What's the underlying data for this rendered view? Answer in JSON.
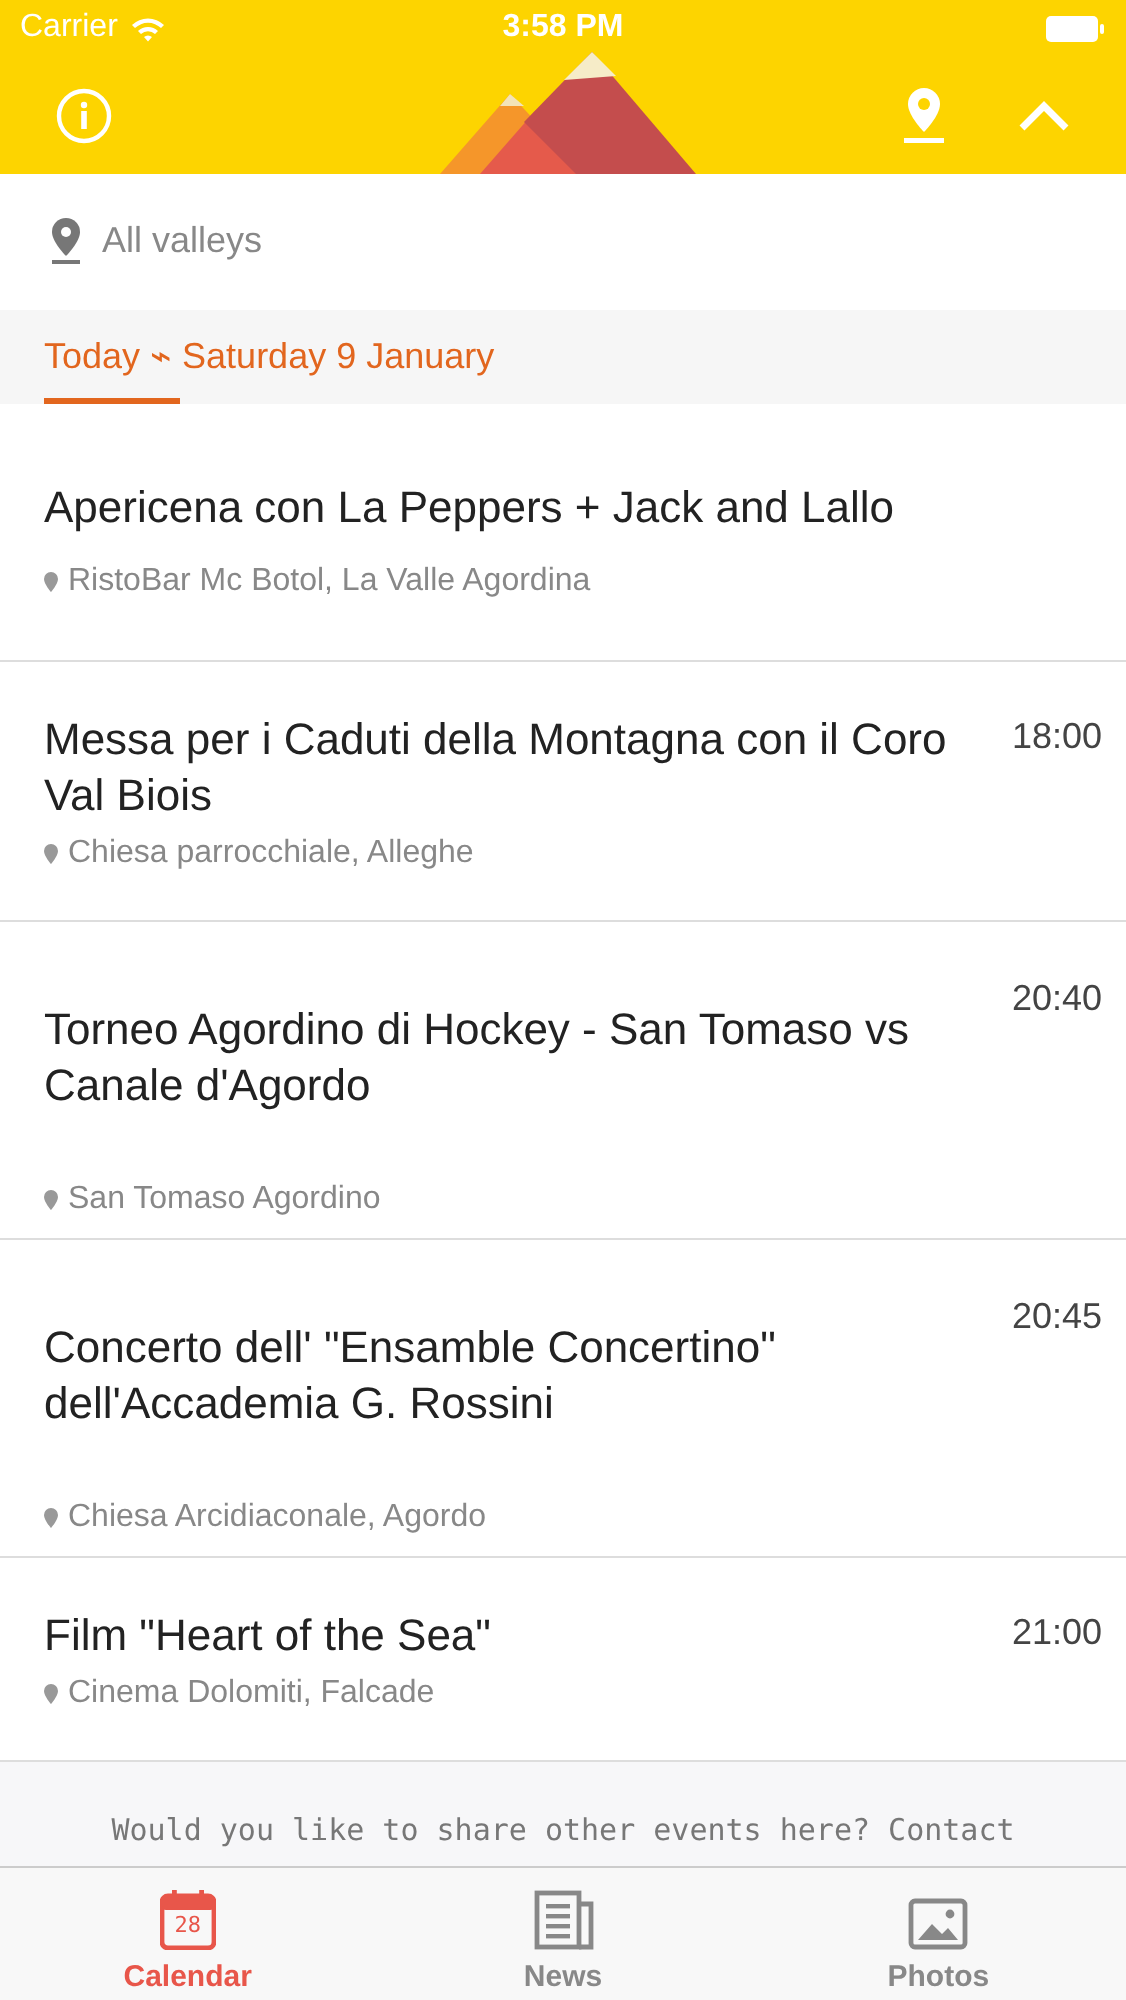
{
  "status_bar": {
    "carrier": "Carrier",
    "time": "3:58 PM"
  },
  "filter": {
    "label": "All valleys"
  },
  "date_tabs": [
    {
      "label": "Today ⌁ Saturday 9 January",
      "selected": true
    }
  ],
  "events": [
    {
      "title": "Apericena con La Peppers + Jack and Lallo",
      "location": "RistoBar Mc Botol, La Valle Agordina"
    },
    {
      "title": "Messa per i Caduti della Montagna con il Coro Val Biois",
      "time": "18:00",
      "location": "Chiesa parrocchiale, Alleghe"
    },
    {
      "title": "Torneo Agordino di Hockey - San Tomaso vs Canale d'Agordo",
      "time": "20:40",
      "location": "San Tomaso Agordino"
    },
    {
      "title": "Concerto dell' \"Ensamble Concertino\" dell'Accademia G. Rossini",
      "time": "20:45",
      "location": "Chiesa Arcidiaconale, Agordo"
    },
    {
      "title": "Film \"Heart of the Sea\"",
      "time": "21:00",
      "location": "Cinema Dolomiti, Falcade"
    }
  ],
  "footer": {
    "text": "Would you like to share other events here? Contact"
  },
  "tab_bar": [
    {
      "kind": "calendar",
      "label": "Calendar",
      "icon_text": "28",
      "selected": true
    },
    {
      "kind": "news",
      "label": "News",
      "selected": false
    },
    {
      "kind": "photos",
      "label": "Photos",
      "selected": false
    }
  ]
}
